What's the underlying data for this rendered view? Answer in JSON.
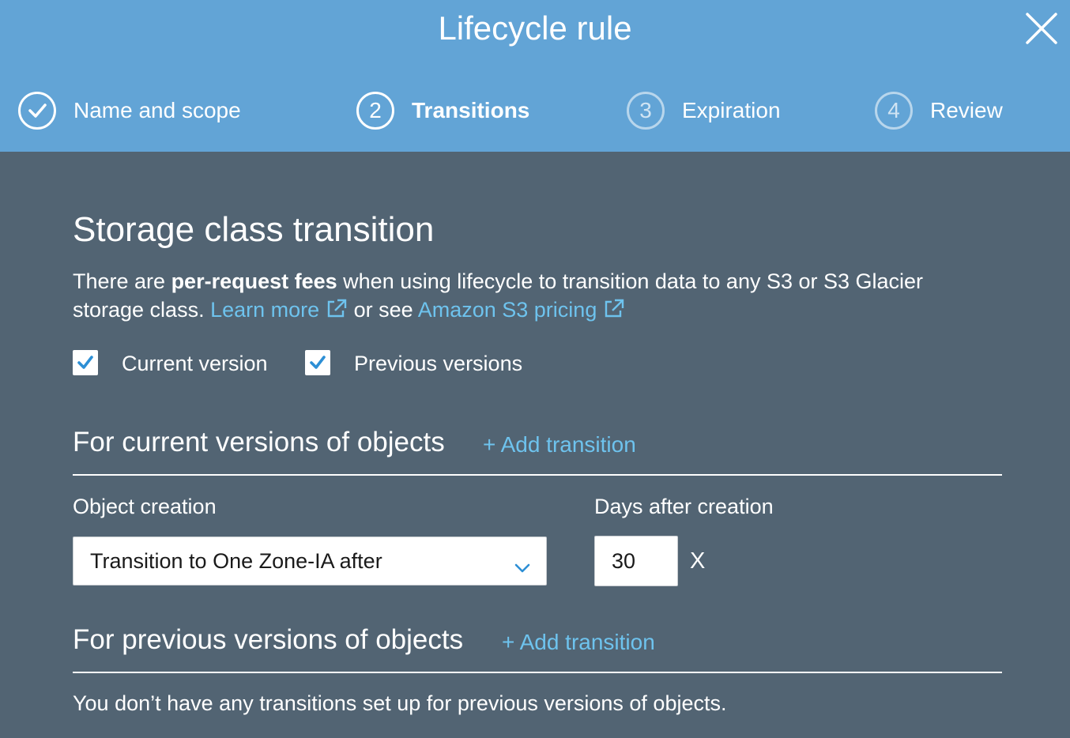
{
  "dialog": {
    "title": "Lifecycle rule",
    "close_icon": "close-icon"
  },
  "steps": [
    {
      "number": "",
      "label": "Name and scope",
      "state": "completed",
      "icon": "checkmark-icon"
    },
    {
      "number": "2",
      "label": "Transitions",
      "state": "active"
    },
    {
      "number": "3",
      "label": "Expiration",
      "state": "upcoming"
    },
    {
      "number": "4",
      "label": "Review",
      "state": "upcoming"
    }
  ],
  "section": {
    "heading": "Storage class transition",
    "intro_before": "There are ",
    "intro_bold": "per-request fees",
    "intro_after": " when using lifecycle to transition data to any S3 or S3 Glacier storage class. ",
    "learn_more": "Learn more",
    "or_see": " or see ",
    "pricing_link": "Amazon S3 pricing",
    "external_icon": "external-link-icon"
  },
  "version_options": [
    {
      "label": "Current version",
      "checked": true
    },
    {
      "label": "Previous versions",
      "checked": true
    }
  ],
  "current_versions": {
    "heading": "For current versions of objects",
    "add_label": "+ Add transition",
    "object_creation_label": "Object creation",
    "days_label": "Days after creation",
    "transition_value": "Transition to One Zone-IA after",
    "days_value": "30",
    "remove_label": "X"
  },
  "previous_versions": {
    "heading": "For previous versions of objects",
    "add_label": "+ Add transition",
    "empty_message": "You don’t have any transitions set up for previous versions of objects."
  },
  "colors": {
    "header_bg": "#62a4d6",
    "body_bg": "#526473",
    "link": "#6ec3ee",
    "checkbox_check": "#2d8fd5"
  }
}
